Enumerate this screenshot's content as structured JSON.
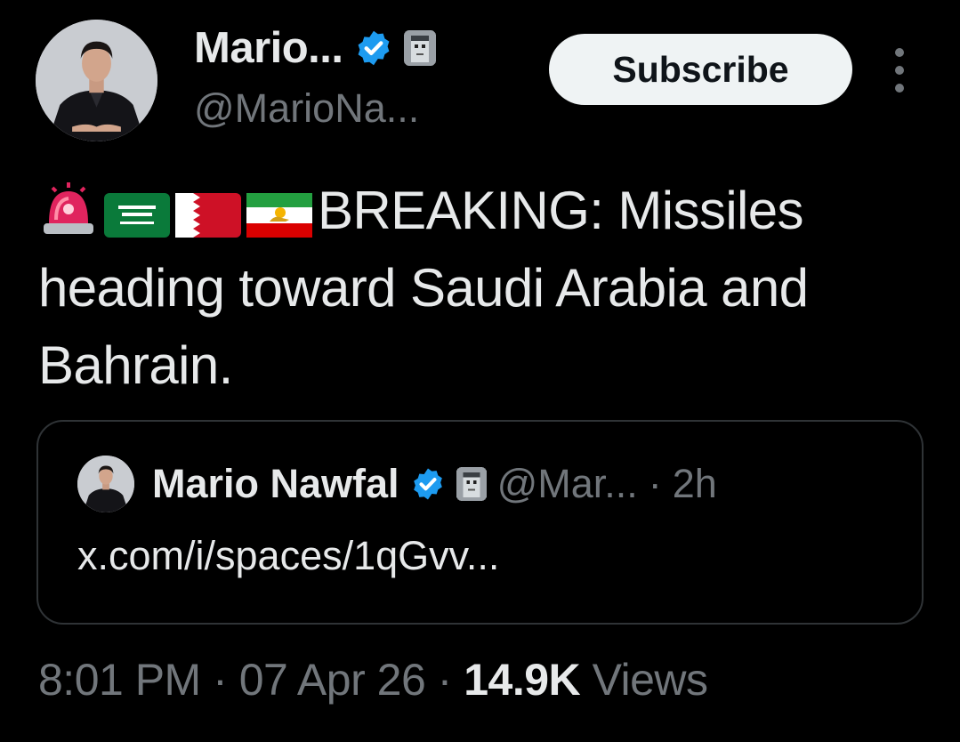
{
  "author": {
    "name": "Mario...",
    "handle": "@MarioNa...",
    "verified_color": "#1d9bf0",
    "avatar_icon": "profile-photo",
    "badge_icon": "pixel-punk-badge"
  },
  "subscribe_label": "Subscribe",
  "more_icon": "more-vertical-icon",
  "tweet": {
    "emojis": [
      "rotating-light-emoji",
      "saudi-arabia-flag",
      "bahrain-flag",
      "iran-lion-sun-flag"
    ],
    "text": "BREAKING: Missiles heading toward Saudi Arabia and Bahrain."
  },
  "quote": {
    "name": "Mario Nawfal",
    "handle": "@Mar...",
    "separator": "·",
    "time": "2h",
    "link": "x.com/i/spaces/1qGvv..."
  },
  "meta": {
    "time": "8:01 PM",
    "sep1": "·",
    "date": "07 Apr 26",
    "sep2": "·",
    "views_count": "14.9K",
    "views_label": "Views"
  },
  "colors": {
    "background": "#000000",
    "text": "#e7e9ea",
    "muted": "#71767b",
    "border": "#2f3336",
    "button_bg": "#eff3f4"
  }
}
